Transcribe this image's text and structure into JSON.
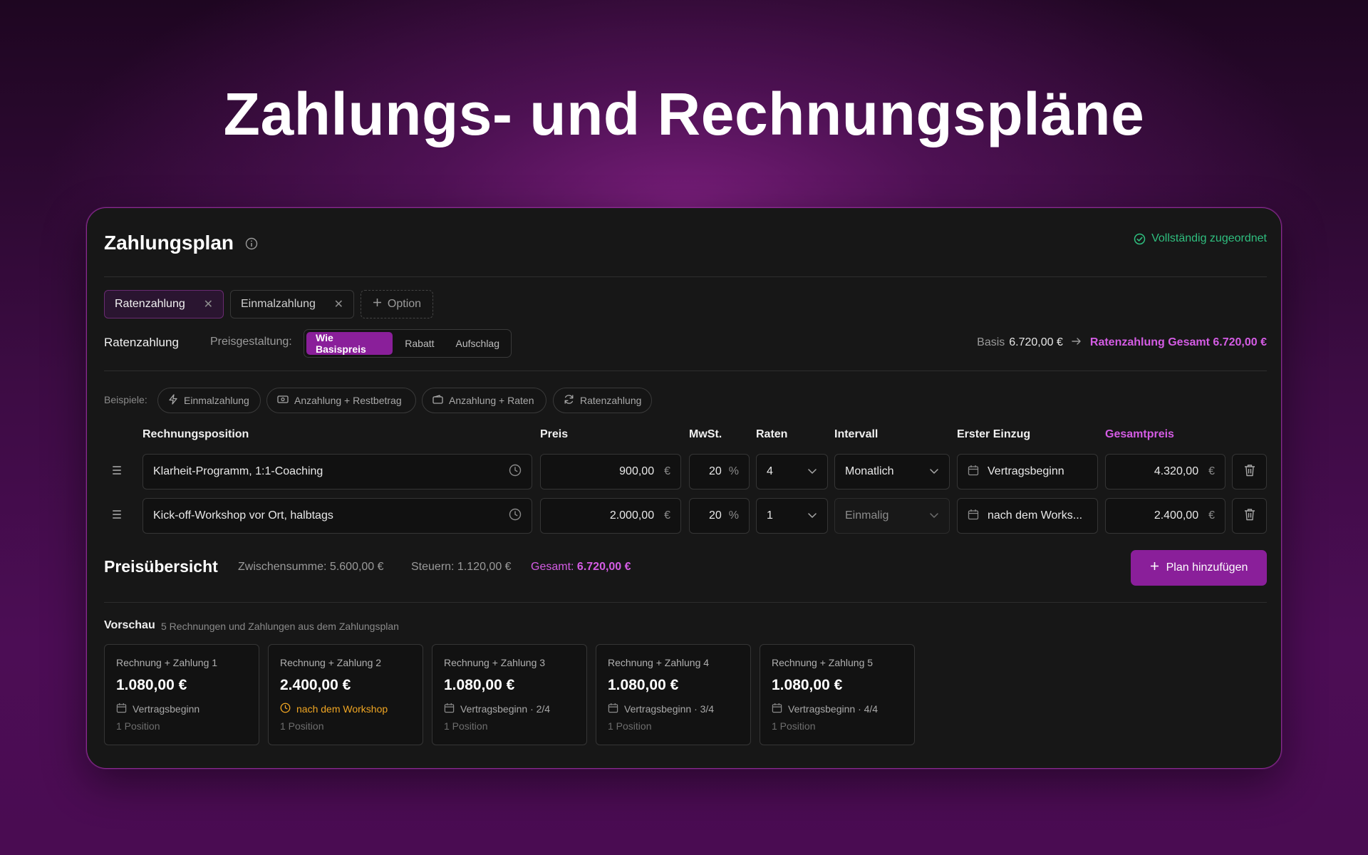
{
  "hero": {
    "title": "Zahlungs- und Rechnungspläne"
  },
  "panel": {
    "title": "Zahlungsplan",
    "status": "Vollständig zugeordnet",
    "tabs": [
      {
        "label": "Ratenzahlung",
        "active": true
      },
      {
        "label": "Einmalzahlung",
        "active": false
      }
    ],
    "add_option_label": "Option",
    "section_label": "Ratenzahlung",
    "pricing": {
      "label": "Preisgestaltung:",
      "options": [
        "Wie Basispreis",
        "Rabatt",
        "Aufschlag"
      ],
      "selected": "Wie Basispreis"
    },
    "totals_line": {
      "basis_label": "Basis",
      "basis_value": "6.720,00 €",
      "result_label": "Ratenzahlung Gesamt 6.720,00 €"
    },
    "examples": {
      "label": "Beispiele:",
      "chips": [
        {
          "label": "Einmalzahlung",
          "icon": "lightning-icon"
        },
        {
          "label": "Anzahlung + Restbetrag",
          "icon": "banknote-icon"
        },
        {
          "label": "Anzahlung + Raten",
          "icon": "wallet-icon"
        },
        {
          "label": "Ratenzahlung",
          "icon": "refresh-icon"
        }
      ]
    },
    "table": {
      "headers": {
        "position": "Rechnungsposition",
        "price": "Preis",
        "vat": "MwSt.",
        "rates": "Raten",
        "interval": "Intervall",
        "first": "Erster Einzug",
        "total": "Gesamtpreis"
      },
      "rows": [
        {
          "position": "Klarheit-Programm, 1:1-Coaching",
          "price": "900,00",
          "currency": "€",
          "vat": "20",
          "vat_unit": "%",
          "rates": "4",
          "interval": "Monatlich",
          "first": "Vertragsbeginn",
          "total": "4.320,00"
        },
        {
          "position": "Kick-off-Workshop vor Ort, halbtags",
          "price": "2.000,00",
          "currency": "€",
          "vat": "20",
          "vat_unit": "%",
          "rates": "1",
          "interval": "Einmalig",
          "first": "nach dem Works...",
          "total": "2.400,00"
        }
      ]
    },
    "summary": {
      "title": "Preisübersicht",
      "subtotal": "Zwischensumme: 5.600,00 €",
      "taxes": "Steuern: 1.120,00 €",
      "total_label": "Gesamt:",
      "total_value": "6.720,00 €",
      "add_plan": "Plan hinzufügen"
    },
    "preview": {
      "title": "Vorschau",
      "subtitle": "5 Rechnungen und Zahlungen aus dem Zahlungsplan",
      "cards": [
        {
          "label": "Rechnung + Zahlung 1",
          "amount": "1.080,00 €",
          "when": "Vertragsbeginn",
          "icon": "calendar-icon",
          "positions": "1 Position"
        },
        {
          "label": "Rechnung + Zahlung 2",
          "amount": "2.400,00 €",
          "when": "nach dem Workshop",
          "icon": "clock-icon",
          "positions": "1 Position"
        },
        {
          "label": "Rechnung + Zahlung 3",
          "amount": "1.080,00 €",
          "when": "Vertragsbeginn · 2/4",
          "icon": "calendar-icon",
          "positions": "1 Position"
        },
        {
          "label": "Rechnung + Zahlung 4",
          "amount": "1.080,00 €",
          "when": "Vertragsbeginn · 3/4",
          "icon": "calendar-icon",
          "positions": "1 Position"
        },
        {
          "label": "Rechnung + Zahlung 5",
          "amount": "1.080,00 €",
          "when": "Vertragsbeginn · 4/4",
          "icon": "calendar-icon",
          "positions": "1 Position"
        }
      ]
    },
    "colors": {
      "accent": "#8a1f9a",
      "accent_text": "#d45ce4",
      "success": "#2fbf7f",
      "warning": "#f0a623"
    }
  }
}
